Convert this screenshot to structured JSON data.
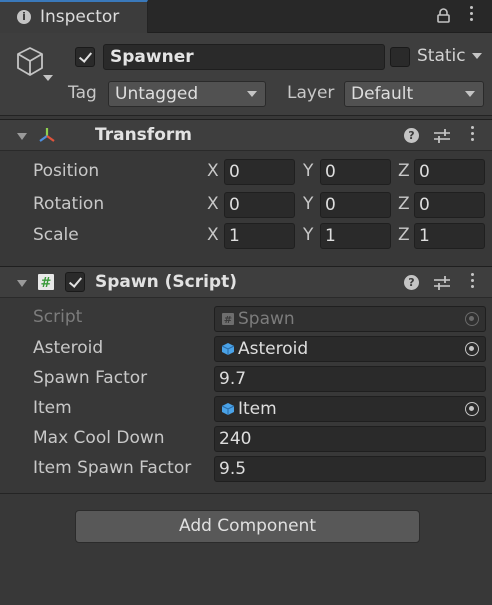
{
  "tab": {
    "title": "Inspector"
  },
  "object": {
    "name": "Spawner",
    "static_label": "Static",
    "tag_label": "Tag",
    "tag_value": "Untagged",
    "layer_label": "Layer",
    "layer_value": "Default"
  },
  "transform": {
    "title": "Transform",
    "rows": [
      {
        "label": "Position",
        "x": "0",
        "y": "0",
        "z": "0"
      },
      {
        "label": "Rotation",
        "x": "0",
        "y": "0",
        "z": "0"
      },
      {
        "label": "Scale",
        "x": "1",
        "y": "1",
        "z": "1"
      }
    ],
    "axes": {
      "x": "X",
      "y": "Y",
      "z": "Z"
    }
  },
  "spawn": {
    "title": "Spawn (Script)",
    "script_label": "Script",
    "script_value": "Spawn",
    "asteroid_label": "Asteroid",
    "asteroid_value": "Asteroid",
    "spawn_factor_label": "Spawn Factor",
    "spawn_factor_value": "9.7",
    "item_label": "Item",
    "item_value": "Item",
    "max_cool_down_label": "Max Cool Down",
    "max_cool_down_value": "240",
    "item_spawn_factor_label": "Item Spawn Factor",
    "item_spawn_factor_value": "9.5"
  },
  "add_component_label": "Add Component",
  "icons": {
    "tab": "info-icon",
    "lock": "lock-icon",
    "menu": "kebab-menu-icon",
    "gameobject": "cube-icon",
    "transform": "transform-axes-icon",
    "script": "csharp-script-icon",
    "help": "help-icon",
    "presets": "presets-sliders-icon",
    "prefab": "prefab-cube-icon",
    "picker": "object-picker-icon"
  }
}
